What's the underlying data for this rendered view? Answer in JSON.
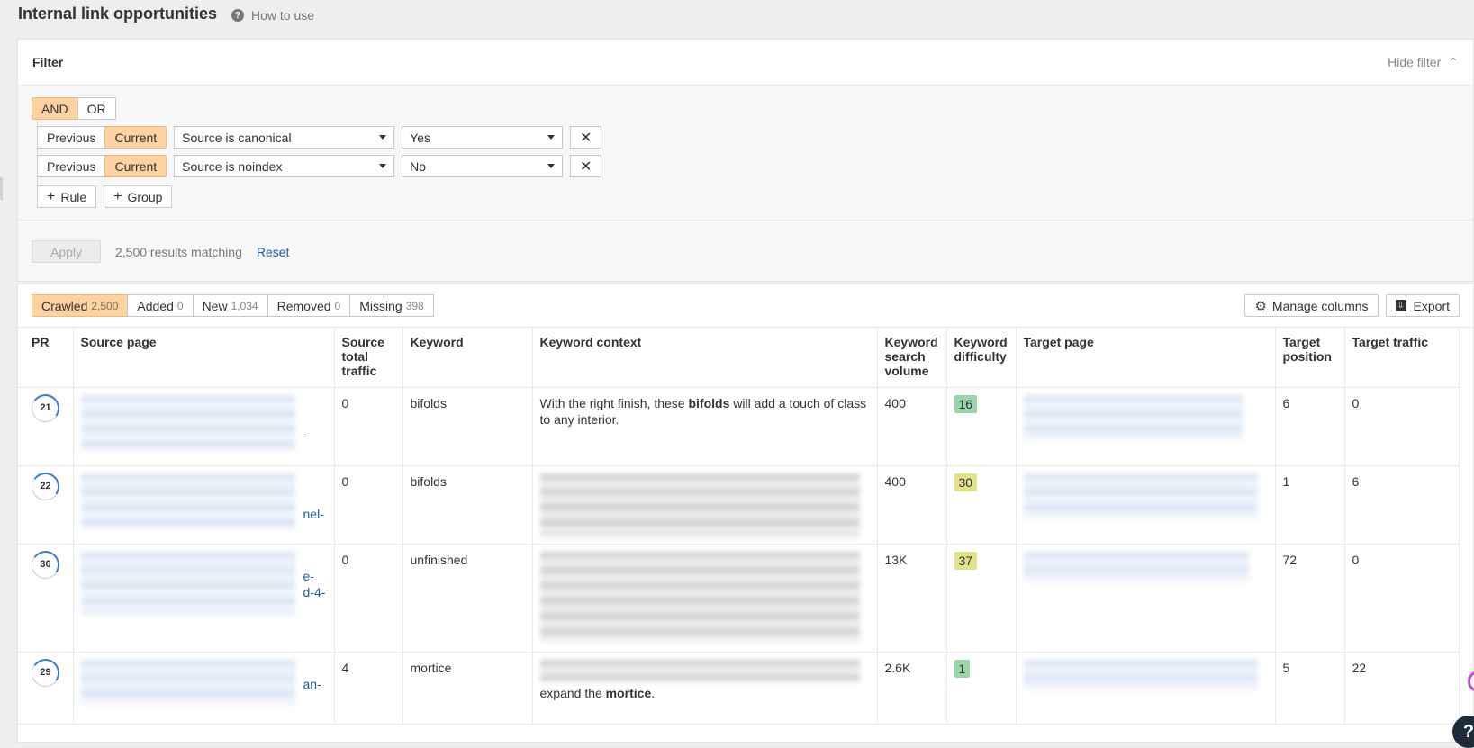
{
  "header": {
    "title": "Internal link opportunities",
    "help_link": "How to use"
  },
  "filter": {
    "title": "Filter",
    "hide_label": "Hide filter",
    "logic": {
      "and": "AND",
      "or": "OR",
      "active": "AND"
    },
    "rules": [
      {
        "previous": "Previous",
        "current": "Current",
        "field": "Source is canonical",
        "value": "Yes"
      },
      {
        "previous": "Previous",
        "current": "Current",
        "field": "Source is noindex",
        "value": "No"
      }
    ],
    "add_rule": "Rule",
    "add_group": "Group",
    "apply": "Apply",
    "matching": "2,500 results matching",
    "reset": "Reset"
  },
  "tabs": [
    {
      "label": "Crawled",
      "count": "2,500",
      "active": true
    },
    {
      "label": "Added",
      "count": "0"
    },
    {
      "label": "New",
      "count": "1,034"
    },
    {
      "label": "Removed",
      "count": "0"
    },
    {
      "label": "Missing",
      "count": "398"
    }
  ],
  "toolbar": {
    "manage_columns": "Manage columns",
    "export": "Export"
  },
  "columns": [
    "PR",
    "Source page",
    "Source total traffic",
    "Keyword",
    "Keyword context",
    "Keyword search volume",
    "Keyword difficulty",
    "Target page",
    "Target position",
    "Target traffic"
  ],
  "rows": [
    {
      "pr": "21",
      "source_visible": "-",
      "source_traffic": "0",
      "keyword": "bifolds",
      "context_before": "With the right finish, these ",
      "context_bold": "bifolds",
      "context_after": " will add a touch of class to any interior.",
      "volume": "400",
      "kd": "16",
      "kd_color": "#9ad6a8",
      "target_position": "6",
      "target_traffic": "0"
    },
    {
      "pr": "22",
      "source_visible": "nel-",
      "source_traffic": "0",
      "keyword": "bifolds",
      "context_before": "",
      "context_bold": "",
      "context_after": "",
      "volume": "400",
      "kd": "30",
      "kd_color": "#e3e18a",
      "target_position": "1",
      "target_traffic": "6"
    },
    {
      "pr": "30",
      "source_visible": "e-\nd-4-",
      "source_traffic": "0",
      "keyword": "unfinished",
      "context_before": "",
      "context_bold": "",
      "context_after": "",
      "volume": "13K",
      "kd": "37",
      "kd_color": "#e3e18a",
      "target_position": "72",
      "target_traffic": "0"
    },
    {
      "pr": "29",
      "source_visible": "an-",
      "source_traffic": "4",
      "keyword": "mortice",
      "context_before": "expand the ",
      "context_bold": "mortice",
      "context_after": ".",
      "volume": "2.6K",
      "kd": "1",
      "kd_color": "#9ad6a8",
      "target_position": "5",
      "target_traffic": "22"
    }
  ],
  "help_button": "?"
}
